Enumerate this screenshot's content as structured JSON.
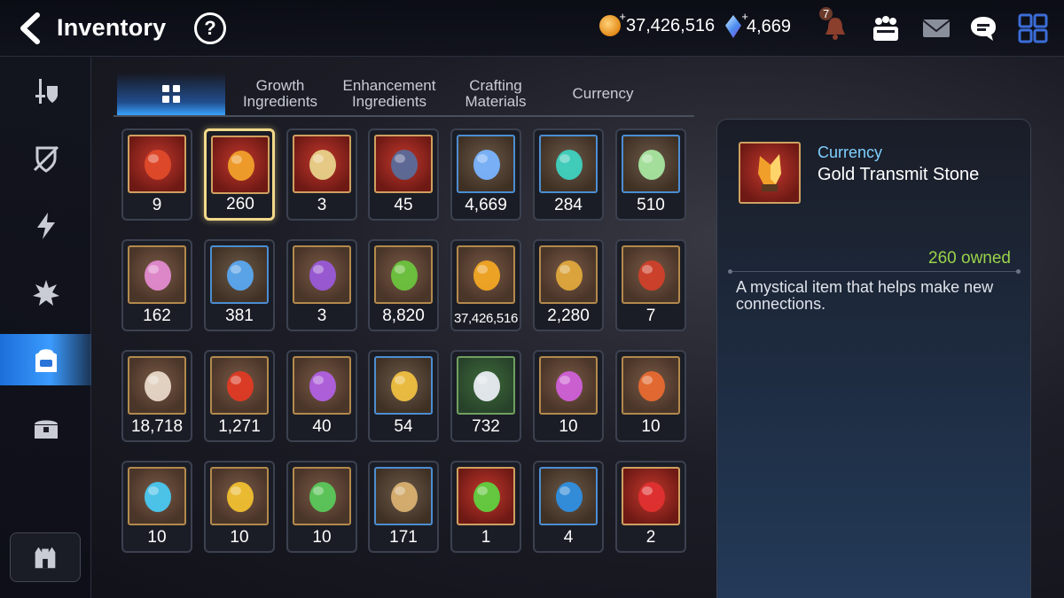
{
  "header": {
    "title": "Inventory",
    "help": "?",
    "gold": "37,426,516",
    "skystone": "4,669",
    "notification_count": "7"
  },
  "tabs": [
    {
      "label": "",
      "icon": "grid-icon",
      "active": true
    },
    {
      "label": "Growth\nIngredients"
    },
    {
      "label": "Enhancement\nIngredients"
    },
    {
      "label": "Crafting\nMaterials"
    },
    {
      "label": "Currency"
    }
  ],
  "sidebar": [
    "equipment",
    "no-equipment",
    "artifact",
    "catalyst",
    "inventory",
    "chest",
    "sanctuary"
  ],
  "items": [
    {
      "count": "9",
      "icon": "red-gear-icon"
    },
    {
      "count": "260",
      "icon": "gold-transmit-stone-icon",
      "selected": true
    },
    {
      "count": "3",
      "icon": "ticket-icon"
    },
    {
      "count": "45",
      "icon": "charm-icon"
    },
    {
      "count": "4,669",
      "icon": "skystone-icon"
    },
    {
      "count": "284",
      "icon": "crystal-icon"
    },
    {
      "count": "510",
      "icon": "leaf-icon"
    },
    {
      "count": "162",
      "icon": "pink-crystal-icon"
    },
    {
      "count": "381",
      "icon": "star-amulet-icon"
    },
    {
      "count": "3",
      "icon": "purple-medal-icon"
    },
    {
      "count": "8,820",
      "icon": "green-heart-icon"
    },
    {
      "count": "37,426,516",
      "icon": "gold-coin-icon"
    },
    {
      "count": "2,280",
      "icon": "fist-emblem-icon"
    },
    {
      "count": "7",
      "icon": "banner-icon"
    },
    {
      "count": "18,718",
      "icon": "horse-statue-icon"
    },
    {
      "count": "1,271",
      "icon": "red-leaf-icon"
    },
    {
      "count": "40",
      "icon": "purple-flower-icon"
    },
    {
      "count": "54",
      "icon": "gold-flower-icon"
    },
    {
      "count": "732",
      "icon": "silver-flower-icon"
    },
    {
      "count": "10",
      "icon": "purple-rune-icon"
    },
    {
      "count": "10",
      "icon": "orange-rune-icon"
    },
    {
      "count": "10",
      "icon": "blue-rune-icon"
    },
    {
      "count": "10",
      "icon": "yellow-rune-icon"
    },
    {
      "count": "10",
      "icon": "green-rune-icon"
    },
    {
      "count": "171",
      "icon": "root-icon"
    },
    {
      "count": "1",
      "icon": "green-gem-icon"
    },
    {
      "count": "4",
      "icon": "blue-circle-icon"
    },
    {
      "count": "2",
      "icon": "red-hexagon-gem-icon"
    }
  ],
  "detail": {
    "category": "Currency",
    "name": "Gold Transmit Stone",
    "owned": "260 owned",
    "description": "A mystical item that helps make new connections."
  }
}
